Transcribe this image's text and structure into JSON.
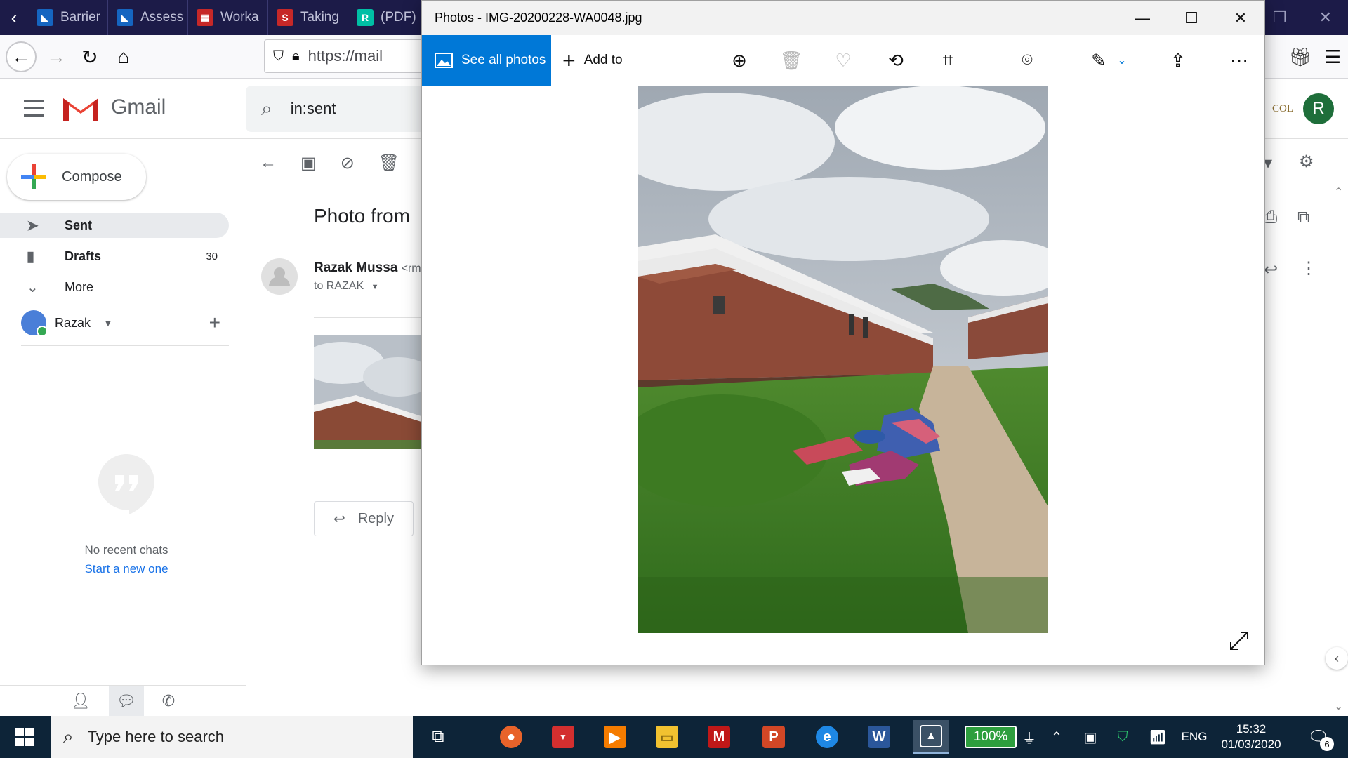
{
  "browser": {
    "tabs": [
      {
        "label": "Barrier",
        "icon": "lambda-icon",
        "color": "#2196f3"
      },
      {
        "label": "Assess",
        "icon": "lambda-icon",
        "color": "#2196f3"
      },
      {
        "label": "Worka",
        "icon": "grid-icon",
        "color": "#c62828"
      },
      {
        "label": "Taking",
        "icon": "s-logo-icon",
        "color": "#c62828"
      },
      {
        "label": "(PDF) I",
        "icon": "researchgate-icon",
        "color": "#00ccbb"
      }
    ],
    "url": "https://mail"
  },
  "gmail": {
    "brand": "Gmail",
    "search_value": "in:sent",
    "compose_label": "Compose",
    "nav": {
      "sent": "Sent",
      "drafts": "Drafts",
      "drafts_count": "30",
      "more": "More"
    },
    "hangouts_user": "Razak",
    "no_chats": "No recent chats",
    "start_new": "Start a new one",
    "avatar_letter": "R",
    "header_fragment": "COL",
    "subject": "Photo from",
    "sender_name": "Razak Mussa",
    "sender_addr": "<rm",
    "to_line": "to RAZAK",
    "reply_label": "Reply"
  },
  "photos_app": {
    "title": "Photos - IMG-20200228-WA0048.jpg",
    "see_all_label": "See all photos",
    "add_to_label": "Add to"
  },
  "taskbar": {
    "search_placeholder": "Type here to search",
    "battery": "100%",
    "language": "ENG",
    "time": "15:32",
    "date": "01/03/2020",
    "notifications": "6"
  },
  "colors": {
    "photos_accent": "#0078d7",
    "gmail_red": "#ea4335",
    "tabstrip": "#1c1b48",
    "taskbar": "#0d2438"
  }
}
